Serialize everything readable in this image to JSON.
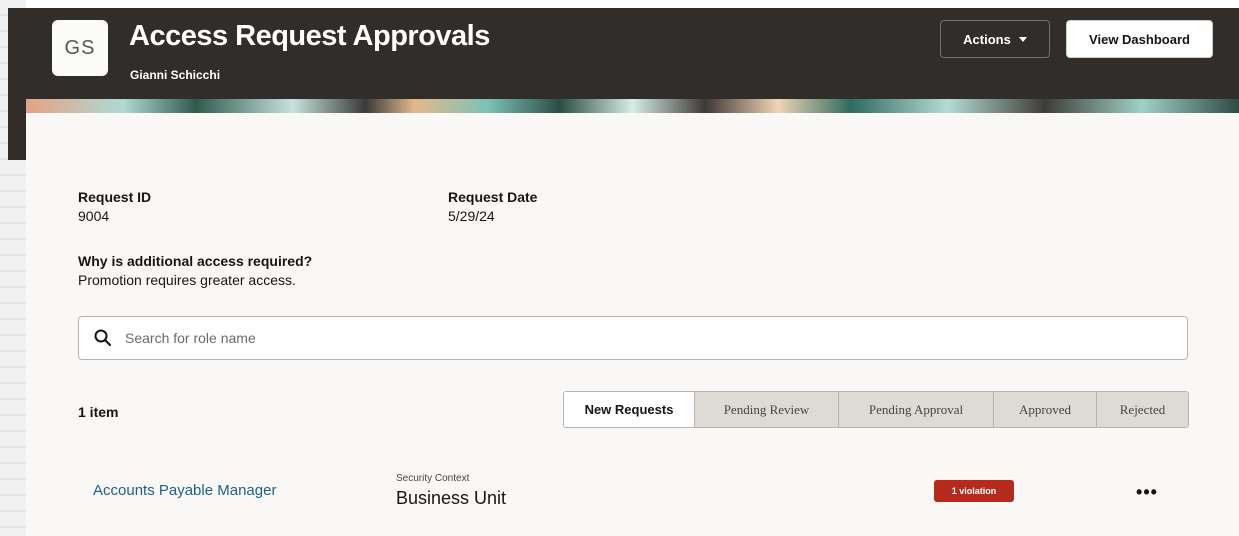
{
  "header": {
    "avatar_initials": "GS",
    "title": "Access Request Approvals",
    "subtitle": "Gianni Schicchi",
    "actions_label": "Actions",
    "dashboard_label": "View Dashboard"
  },
  "details": {
    "request_id_label": "Request ID",
    "request_id_value": "9004",
    "request_date_label": "Request Date",
    "request_date_value": "5/29/24",
    "why_label": "Why is additional access required?",
    "why_value": "Promotion requires greater access."
  },
  "search": {
    "placeholder": "Search for role name",
    "value": ""
  },
  "list": {
    "count_label": "1 item",
    "tabs": [
      {
        "label": "New Requests",
        "active": true
      },
      {
        "label": "Pending Review",
        "active": false
      },
      {
        "label": "Pending Approval",
        "active": false
      },
      {
        "label": "Approved",
        "active": false
      },
      {
        "label": "Rejected",
        "active": false
      }
    ],
    "rows": [
      {
        "role": "Accounts Payable Manager",
        "context_label": "Security Context",
        "context_value": "Business Unit",
        "badge": "1 violation",
        "more_glyph": "•••"
      }
    ]
  },
  "colors": {
    "header_bg": "#312d2a",
    "link": "#1f5f8b",
    "violation": "#b42a1d"
  }
}
